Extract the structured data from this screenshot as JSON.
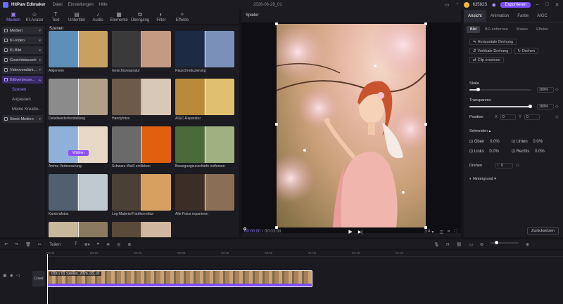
{
  "titlebar": {
    "app": "HitPaw Edimaker",
    "menu": [
      "Datei",
      "Einstellungen",
      "Hilfe"
    ],
    "project": "2026-06-29_01",
    "coins": "63582S",
    "export": "Exportieren"
  },
  "toolbar": [
    {
      "label": "Medien",
      "icon": "folder-icon",
      "active": true
    },
    {
      "label": "KI-Avatar",
      "icon": "avatar-icon"
    },
    {
      "label": "Text",
      "icon": "text-icon"
    },
    {
      "label": "Untertitel",
      "icon": "subtitle-icon"
    },
    {
      "label": "Audio",
      "icon": "audio-icon"
    },
    {
      "label": "Elemente",
      "icon": "elements-icon"
    },
    {
      "label": "Übergang",
      "icon": "transition-icon"
    },
    {
      "label": "Filter",
      "icon": "filter-icon"
    },
    {
      "label": "Effekte",
      "icon": "effects-icon"
    }
  ],
  "sidebar": {
    "items": [
      {
        "label": "Medien"
      },
      {
        "label": "KI-Video"
      },
      {
        "label": "KI-Bild"
      },
      {
        "label": "Gesichtstausch"
      },
      {
        "label": "Videoverstärk..."
      },
      {
        "label": "Bildverbesse..."
      }
    ],
    "subitems": [
      "Szenen",
      "Anpassen",
      "Meine Kreatio..."
    ],
    "stock": "Stock-Medien"
  },
  "gallery": {
    "header": "Szenen",
    "cards": [
      {
        "label": "Allgemein",
        "c1": "#5d8fb8",
        "c2": "#c8a060"
      },
      {
        "label": "Gesichtsreparatur",
        "c1": "#3a3a3a",
        "c2": "#c49a82"
      },
      {
        "label": "Rauschreduzierung",
        "c1": "#1c2a44",
        "c2": "#7a90b8"
      },
      {
        "label": "Detailwiederherstellung",
        "c1": "#8b8b8b",
        "c2": "#b0a08a"
      },
      {
        "label": "Handyfotos",
        "c1": "#6e5a4a",
        "c2": "#d8c8b8"
      },
      {
        "label": "AIGC-Reparatur",
        "c1": "#b88a3a",
        "c2": "#e0c070"
      },
      {
        "label": "Anime-Verbesserung",
        "c1": "#8fb0d8",
        "c2": "#e8d8c8",
        "button": "Wählen"
      },
      {
        "label": "Schwarz-Weiß einfärben",
        "c1": "#6a6a6a",
        "c2": "#e06010"
      },
      {
        "label": "Bewegungsunschärfe entfernen",
        "c1": "#4a6a3a",
        "c2": "#a0b080"
      },
      {
        "label": "Kamerafotos",
        "c1": "#506070",
        "c2": "#c0c8d0"
      },
      {
        "label": "Log-Material Farbkorrektur",
        "c1": "#4a4036",
        "c2": "#d8a060"
      },
      {
        "label": "Alte Fotos reparieren",
        "c1": "#3a2e26",
        "c2": "#8a6e56"
      },
      {
        "label": "",
        "c1": "#c8b89a",
        "c2": "#8a7a60"
      },
      {
        "label": "",
        "c1": "#5a4a3a",
        "c2": "#d0b8a0"
      }
    ]
  },
  "player": {
    "title": "Spieler",
    "time": "00:00:00",
    "duration": "00:03:00",
    "ratio": "3:4"
  },
  "props": {
    "tabs": [
      "Ansicht",
      "Animation",
      "Farbe",
      "AIGC"
    ],
    "subtabs": [
      "Bild",
      "BG entfernen",
      "Maske",
      "Effekte"
    ],
    "buttons": [
      "Horizontale Drehung",
      "Vertikale Drehung",
      "Drehen",
      "Clip ersetzen"
    ],
    "scale_label": "Skala",
    "scale_val": "100%",
    "opacity_label": "Transparenz",
    "opacity_val": "100%",
    "position_label": "Position",
    "pos_x": "X",
    "pos_x_val": "0",
    "pos_y": "Y",
    "pos_y_val": "0",
    "crop_label": "Schneiden",
    "crop": [
      {
        "label": "Oben",
        "val": "0.0%"
      },
      {
        "label": "Unten",
        "val": "0.0%"
      },
      {
        "label": "Links",
        "val": "0.0%"
      },
      {
        "label": "Rechts",
        "val": "0.0%"
      }
    ],
    "rotate_label": "Drehen",
    "rotate_val": "0",
    "bg_label": "Hintergrund",
    "reset": "Zurücksetzen"
  },
  "timeline": {
    "tools": [
      "Teilen"
    ],
    "ticks": [
      "00:00",
      "00:10",
      "00:20",
      "00:30",
      "00:40",
      "00:50",
      "01:00",
      "01:10",
      "01:20"
    ],
    "cover": "Cover",
    "clip_name": "0:00 / 01 Szenen_2026_03_02"
  }
}
